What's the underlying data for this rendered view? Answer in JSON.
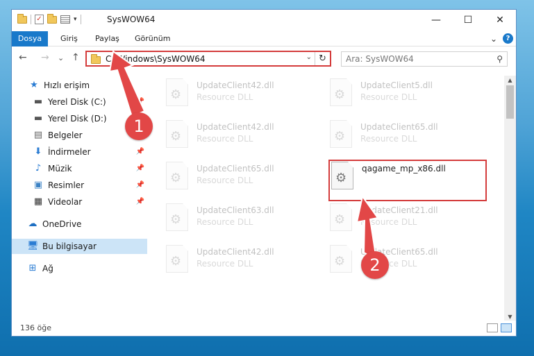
{
  "window": {
    "title": "SysWOW64",
    "controls": {
      "minimize": "—",
      "maximize": "☐",
      "close": "✕"
    }
  },
  "ribbon": {
    "tabs": [
      "Dosya",
      "Giriş",
      "Paylaş",
      "Görünüm"
    ],
    "expand": "⌄",
    "help": "?"
  },
  "nav": {
    "back": "←",
    "forward": "→",
    "recent": "⌄",
    "up": "↑",
    "address": "C:\\Windows\\SysWOW64",
    "address_dropdown": "⌄",
    "refresh": "↻",
    "search_placeholder": "Ara: SysWOW64"
  },
  "sidebar": {
    "items": [
      {
        "label": "Hızlı erişim",
        "icon": "star-icon",
        "pinned": false
      },
      {
        "label": "Yerel Disk (C:)",
        "icon": "drive-icon",
        "pinned": true
      },
      {
        "label": "Yerel Disk (D:)",
        "icon": "drive-icon",
        "pinned": true
      },
      {
        "label": "Belgeler",
        "icon": "document-icon",
        "pinned": true
      },
      {
        "label": "İndirmeler",
        "icon": "download-icon",
        "pinned": true
      },
      {
        "label": "Müzik",
        "icon": "music-icon",
        "pinned": true
      },
      {
        "label": "Resimler",
        "icon": "picture-icon",
        "pinned": true
      },
      {
        "label": "Videolar",
        "icon": "video-icon",
        "pinned": true
      },
      {
        "label": "OneDrive",
        "icon": "cloud-icon",
        "pinned": false
      },
      {
        "label": "Bu bilgisayar",
        "icon": "computer-icon",
        "pinned": false,
        "selected": true
      },
      {
        "label": "Ağ",
        "icon": "network-icon",
        "pinned": false
      }
    ]
  },
  "files": [
    {
      "name": "UpdateClient42.dll",
      "type": "Resource DLL"
    },
    {
      "name": "UpdateClient5.dll",
      "type": "Resource DLL"
    },
    {
      "name": "UpdateClient42.dll",
      "type": "Resource DLL"
    },
    {
      "name": "UpdateClient65.dll",
      "type": "Resource DLL"
    },
    {
      "name": "UpdateClient65.dll",
      "type": "Resource DLL"
    },
    {
      "name": "qagame_mp_x86.dll",
      "type": "",
      "highlighted": true
    },
    {
      "name": "UpdateClient63.dll",
      "type": "Resource DLL"
    },
    {
      "name": "UpdateClient21.dll",
      "type": "Resource DLL"
    },
    {
      "name": "UpdateClient42.dll",
      "type": "Resource DLL"
    },
    {
      "name": "UpdateClient65.dll",
      "type": "Resource DLL"
    }
  ],
  "status": {
    "count": "136 öğe"
  },
  "callouts": [
    "1",
    "2"
  ],
  "colors": {
    "accent": "#1979ca",
    "highlight_border": "#d43b3b",
    "callout": "#e24747",
    "selected": "#cce4f7"
  }
}
